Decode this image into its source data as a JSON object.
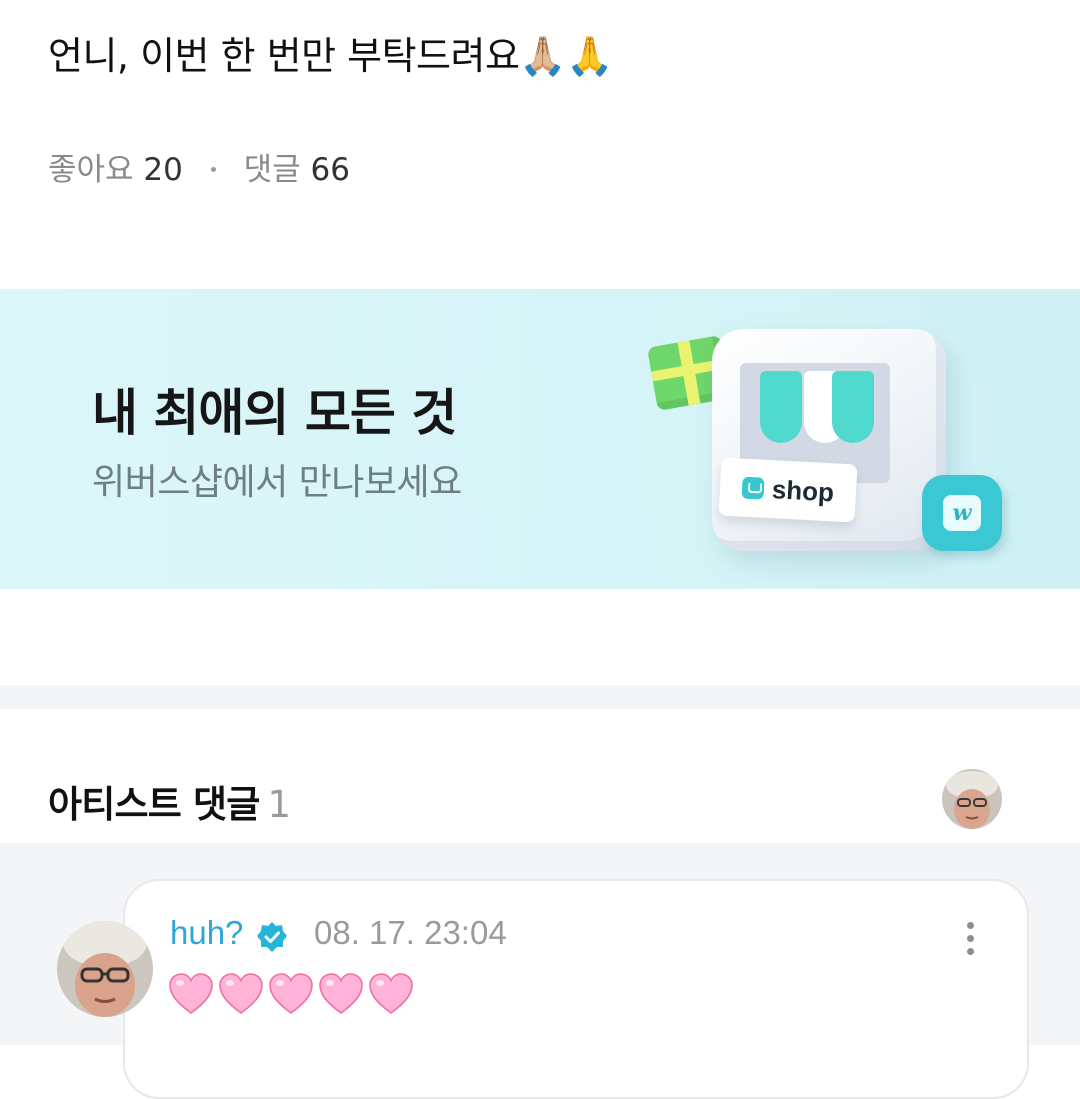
{
  "post": {
    "title": "언니, 이번 한 번만 부탁드려요🙏🏼🙏",
    "likes_label": "좋아요",
    "likes_count": "20",
    "comments_label": "댓글",
    "comments_count": "66"
  },
  "banner": {
    "headline": "내 최애의 모든 것",
    "subtitle": "위버스샵에서 만나보세요",
    "shop_sign": "shop",
    "bag_letter": "w"
  },
  "artist_comments": {
    "title": "아티스트 댓글",
    "count": "1",
    "comment": {
      "author": "huh?",
      "timestamp": "08. 17. 23:04",
      "hearts": 5,
      "heart_color": "#ffb3d6"
    }
  },
  "colors": {
    "author_blue": "#2ea8d2",
    "verified_badge": "#28b4d8",
    "banner_bg": "#d6f4f7"
  }
}
